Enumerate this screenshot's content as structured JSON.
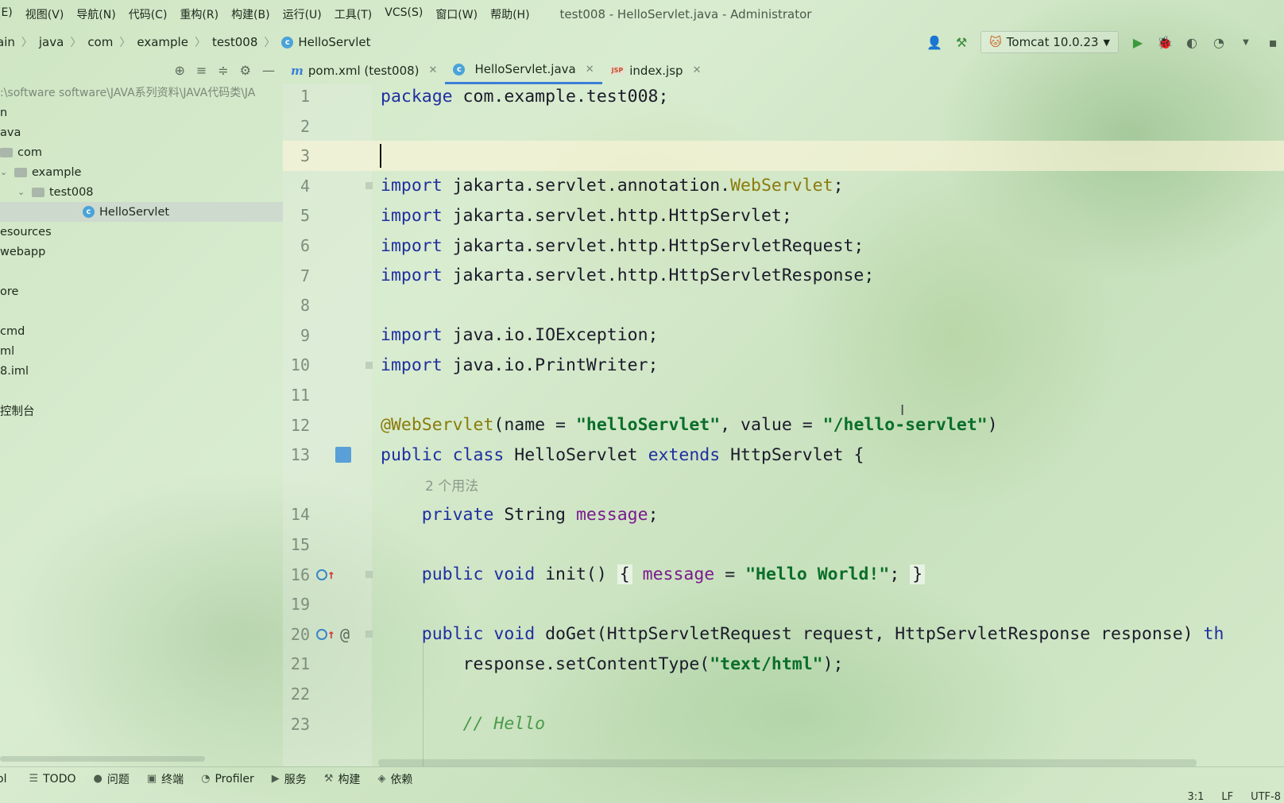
{
  "menu": [
    "(E)",
    "视图(V)",
    "导航(N)",
    "代码(C)",
    "重构(R)",
    "构建(B)",
    "运行(U)",
    "工具(T)",
    "VCS(S)",
    "窗口(W)",
    "帮助(H)"
  ],
  "window_title": "test008 - HelloServlet.java - Administrator",
  "breadcrumb": [
    "ain",
    "java",
    "com",
    "example",
    "test008",
    "HelloServlet"
  ],
  "run_config": "Tomcat 10.0.23",
  "project": {
    "path": ":\\software software\\JAVA系列资料\\JAVA代码类\\JA",
    "items": [
      {
        "label": "n",
        "indent": 0,
        "icon": false,
        "chevron": ""
      },
      {
        "label": "ava",
        "indent": 0,
        "icon": false,
        "chevron": ""
      },
      {
        "label": "com",
        "indent": 0,
        "icon": true,
        "chevron": ""
      },
      {
        "label": "example",
        "indent": 0,
        "icon": true,
        "chevron": "⌄"
      },
      {
        "label": "test008",
        "indent": 1,
        "icon": true,
        "chevron": "⌄"
      },
      {
        "label": "HelloServlet",
        "indent": 2,
        "icon": false,
        "chevron": "",
        "class": true,
        "selected": true
      },
      {
        "label": "esources",
        "indent": 0,
        "icon": false,
        "chevron": ""
      },
      {
        "label": "webapp",
        "indent": 0,
        "icon": false,
        "chevron": ""
      },
      {
        "label": "",
        "indent": 0,
        "icon": false,
        "chevron": ""
      },
      {
        "label": "ore",
        "indent": 0,
        "icon": false,
        "chevron": ""
      },
      {
        "label": "",
        "indent": 0,
        "icon": false,
        "chevron": ""
      },
      {
        "label": "cmd",
        "indent": 0,
        "icon": false,
        "chevron": ""
      },
      {
        "label": "ml",
        "indent": 0,
        "icon": false,
        "chevron": ""
      },
      {
        "label": "8.iml",
        "indent": 0,
        "icon": false,
        "chevron": ""
      },
      {
        "label": "",
        "indent": 0,
        "icon": false,
        "chevron": ""
      },
      {
        "label": "控制台",
        "indent": 0,
        "icon": false,
        "chevron": ""
      }
    ]
  },
  "tabs": [
    {
      "label": "pom.xml (test008)",
      "icon": "maven-icon",
      "active": false
    },
    {
      "label": "HelloServlet.java",
      "icon": "class-icon",
      "active": true
    },
    {
      "label": "index.jsp",
      "icon": "jsp-icon",
      "active": false
    }
  ],
  "code_lines": [
    {
      "num": "1",
      "html": "<span class='kw'>package</span> com.example.test008;"
    },
    {
      "num": "2",
      "html": ""
    },
    {
      "num": "3",
      "html": "",
      "current": true
    },
    {
      "num": "4",
      "html": "<span class='kw'>import</span> jakarta.servlet.annotation.<span class='ann'>WebServlet</span>;"
    },
    {
      "num": "5",
      "html": "<span class='kw'>import</span> jakarta.servlet.http.HttpServlet;"
    },
    {
      "num": "6",
      "html": "<span class='kw'>import</span> jakarta.servlet.http.HttpServletRequest;"
    },
    {
      "num": "7",
      "html": "<span class='kw'>import</span> jakarta.servlet.http.HttpServletResponse;"
    },
    {
      "num": "8",
      "html": ""
    },
    {
      "num": "9",
      "html": "<span class='kw'>import</span> java.io.IOException;"
    },
    {
      "num": "10",
      "html": "<span class='kw'>import</span> java.io.PrintWriter;"
    },
    {
      "num": "11",
      "html": ""
    },
    {
      "num": "12",
      "html": "<span class='ann'>@WebServlet</span>(name = <span class='str'>\"helloServlet\"</span>, value = <span class='str'>\"/hello-servlet\"</span>)"
    },
    {
      "num": "13",
      "html": "<span class='kw'>public class</span> HelloServlet <span class='kw'>extends</span> HttpServlet {"
    },
    {
      "num": "",
      "hint": "2 个用法"
    },
    {
      "num": "14",
      "html": "    <span class='kw'>private</span> String <span class='fld'>message</span>;"
    },
    {
      "num": "15",
      "html": ""
    },
    {
      "num": "16",
      "html": "    <span class='kw'>public void</span> init() <span class='brace-box'>{</span> <span class='fld'>message</span> = <span class='str'>\"Hello World!\"</span>; <span class='brace-box'>}</span>"
    },
    {
      "num": "19",
      "html": ""
    },
    {
      "num": "20",
      "html": "    <span class='kw'>public void</span> doGet(HttpServletRequest request, HttpServletResponse response) <span class='kw'>th</span>"
    },
    {
      "num": "21",
      "html": "        response.setContentType(<span class='str'>\"text/html\"</span>);"
    },
    {
      "num": "22",
      "html": ""
    },
    {
      "num": "23",
      "html": "        <span class='cmt'>// Hello</span>"
    }
  ],
  "bottom_tools": [
    {
      "label": "ol",
      "icon": ""
    },
    {
      "label": "TODO",
      "icon": "☰"
    },
    {
      "label": "问题",
      "icon": "●"
    },
    {
      "label": "终端",
      "icon": "▣"
    },
    {
      "label": "Profiler",
      "icon": "◔"
    },
    {
      "label": "服务",
      "icon": "▶"
    },
    {
      "label": "构建",
      "icon": "⚒"
    },
    {
      "label": "依赖",
      "icon": "◈"
    }
  ],
  "status": {
    "position": "3:1",
    "line_sep": "LF",
    "encoding": "UTF-8"
  }
}
